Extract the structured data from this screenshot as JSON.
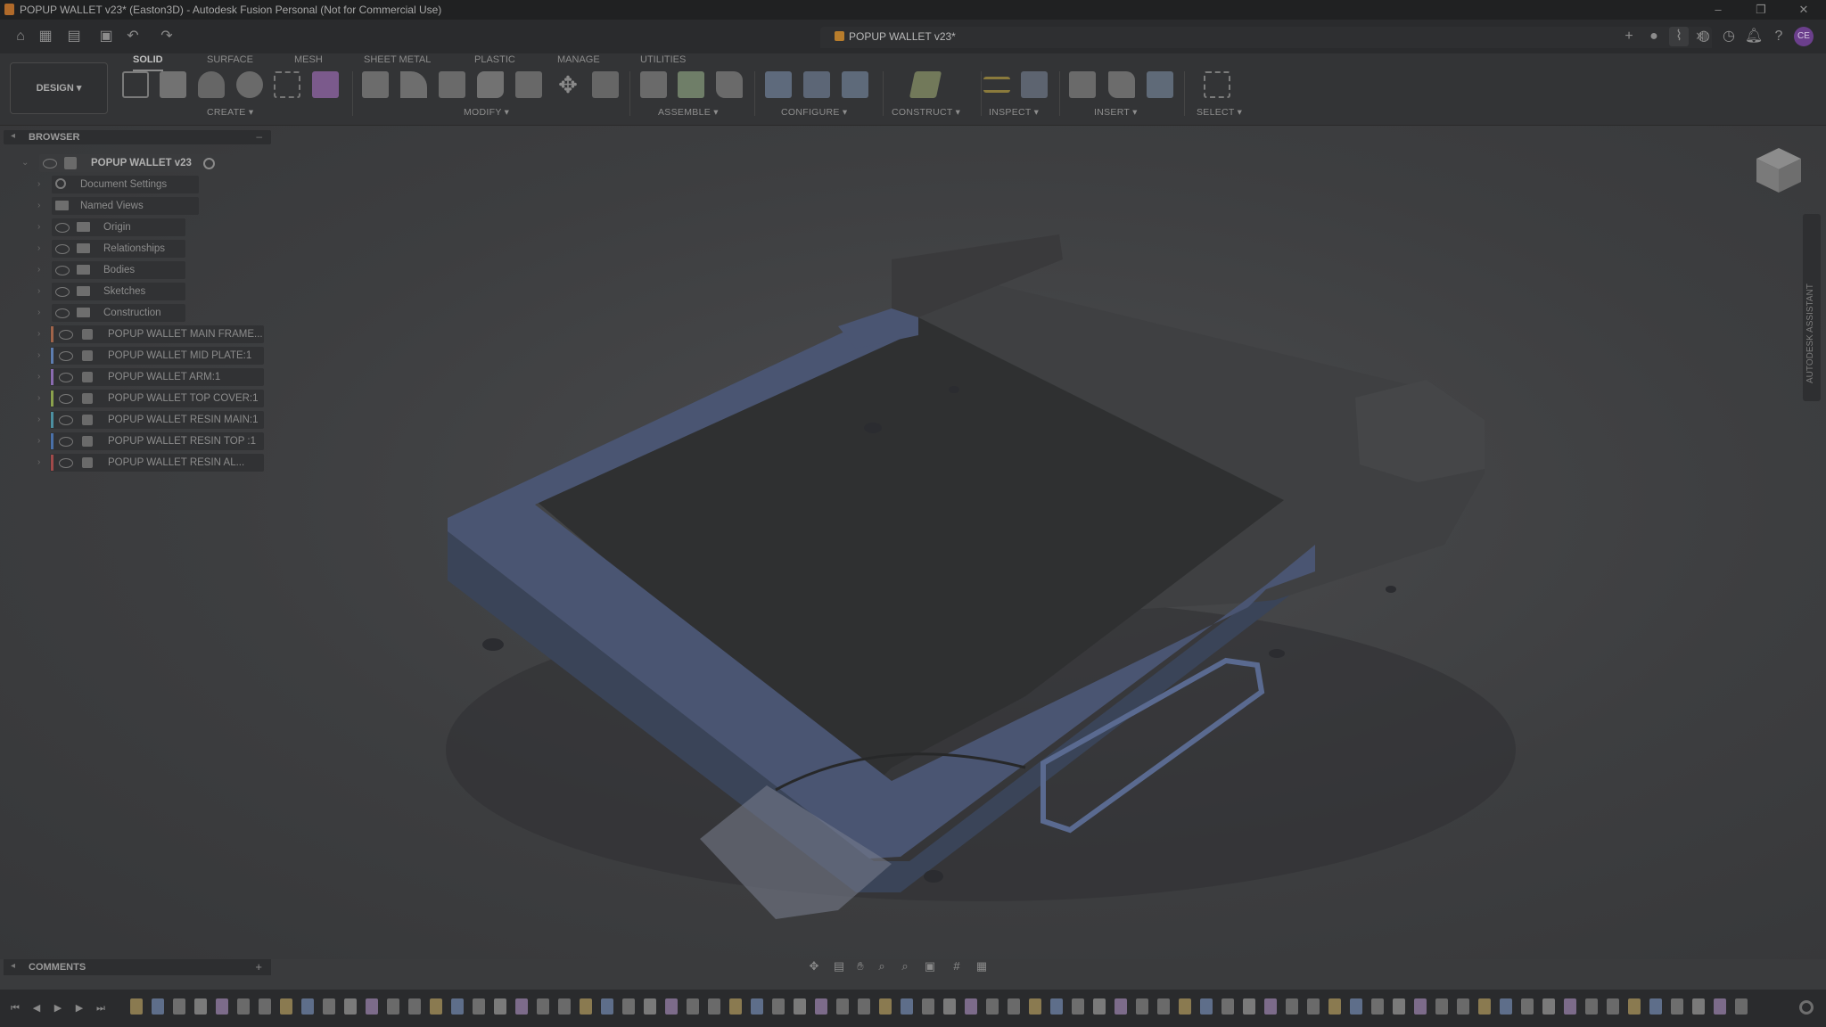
{
  "window": {
    "title": "POPUP WALLET v23* (Easton3D) - Autodesk Fusion Personal (Not for Commercial Use)",
    "minimize": "–",
    "restore": "❐",
    "close": "✕"
  },
  "doc_tab": {
    "label": "POPUP WALLET v23*",
    "close": "✕"
  },
  "user_initials": "CE",
  "workspace": {
    "label": "DESIGN ▾"
  },
  "tabs": [
    "SOLID",
    "SURFACE",
    "MESH",
    "SHEET METAL",
    "PLASTIC",
    "MANAGE",
    "UTILITIES"
  ],
  "active_tab": "SOLID",
  "tool_groups": [
    "CREATE ▾",
    "MODIFY ▾",
    "ASSEMBLE ▾",
    "CONFIGURE ▾",
    "CONSTRUCT ▾",
    "INSPECT ▾",
    "INSERT ▾",
    "SELECT ▾"
  ],
  "browser": {
    "header": "BROWSER",
    "root": "POPUP WALLET v23",
    "items": [
      {
        "label": "Document Settings",
        "icon": "gear-icon",
        "eye": false
      },
      {
        "label": "Named Views",
        "icon": "folder-icon",
        "eye": false
      },
      {
        "label": "Origin",
        "icon": "folder-icon",
        "eye": true
      },
      {
        "label": "Relationships",
        "icon": "folder-icon",
        "eye": true
      },
      {
        "label": "Bodies",
        "icon": "folder-icon",
        "eye": true
      },
      {
        "label": "Sketches",
        "icon": "folder-icon",
        "eye": true
      },
      {
        "label": "Construction",
        "icon": "folder-icon",
        "eye": true
      }
    ],
    "components": [
      {
        "label": "POPUP WALLET MAIN FRAME...",
        "color": "#a0644a"
      },
      {
        "label": "POPUP WALLET MID PLATE:1",
        "color": "#5d7db0"
      },
      {
        "label": "POPUP WALLET ARM:1",
        "color": "#8a6bb0"
      },
      {
        "label": "POPUP WALLET TOP COVER:1",
        "color": "#8aa04c"
      },
      {
        "label": "POPUP WALLET RESIN MAIN:1",
        "color": "#4c8fa0"
      },
      {
        "label": "POPUP WALLET RESIN TOP :1",
        "color": "#4a70a8"
      },
      {
        "label": "POPUP WALLET RESIN AL...",
        "color": "#a04a4a"
      }
    ]
  },
  "assistant_label": "AUTODESK ASSISTANT",
  "comments": {
    "header": "COMMENTS",
    "add": "+"
  }
}
